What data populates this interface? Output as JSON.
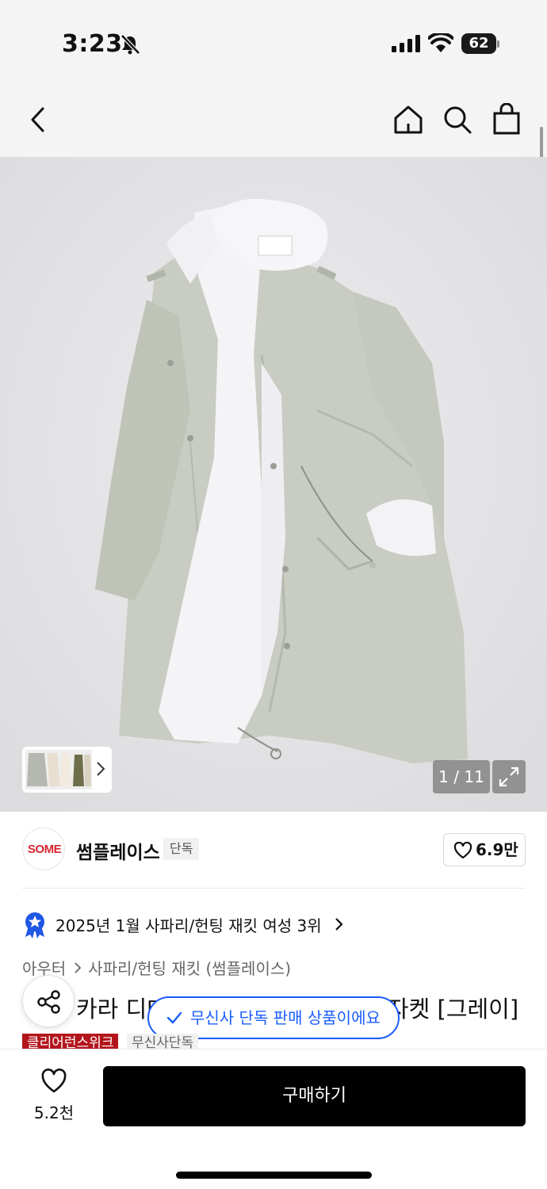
{
  "status_bar": {
    "time": "3:23",
    "battery": "62",
    "icons": [
      "bell-slash-icon",
      "signal-icon",
      "wifi-icon",
      "battery-icon"
    ]
  },
  "nav": {
    "icons": [
      "back-arrow-icon",
      "home-icon",
      "search-icon",
      "shopping-bag-icon"
    ]
  },
  "gallery": {
    "counter": "1 / 11",
    "current": 1,
    "total": 11,
    "icons": [
      "expand-icon",
      "chevron-right-icon"
    ]
  },
  "brand": {
    "logo_text": "SOME",
    "name": "썸플레이스",
    "badge": "단독",
    "likes": "6.9만",
    "logo_color": "#d6262d"
  },
  "ranking": {
    "text": "2025년 1월 사파리/헌팅 재킷 여성 3위",
    "accent_color": "#1f57e6"
  },
  "breadcrumb": [
    "아우터",
    "사파리/헌팅 재킷 (썸플레이스)"
  ],
  "product": {
    "title": "카라 디테일 오버핏 무스탕 야상 자켓 [그레이]",
    "tags": [
      "클리어런스위크",
      "무신사단독"
    ],
    "tag_colors": [
      "#b3151c",
      "#f1f1f1"
    ]
  },
  "toast": {
    "message": "무신사 단독 판매 상품이에요",
    "color": "#1a5cff"
  },
  "bottom_bar": {
    "wish_count": "5.2천",
    "buy_label": "구매하기"
  }
}
